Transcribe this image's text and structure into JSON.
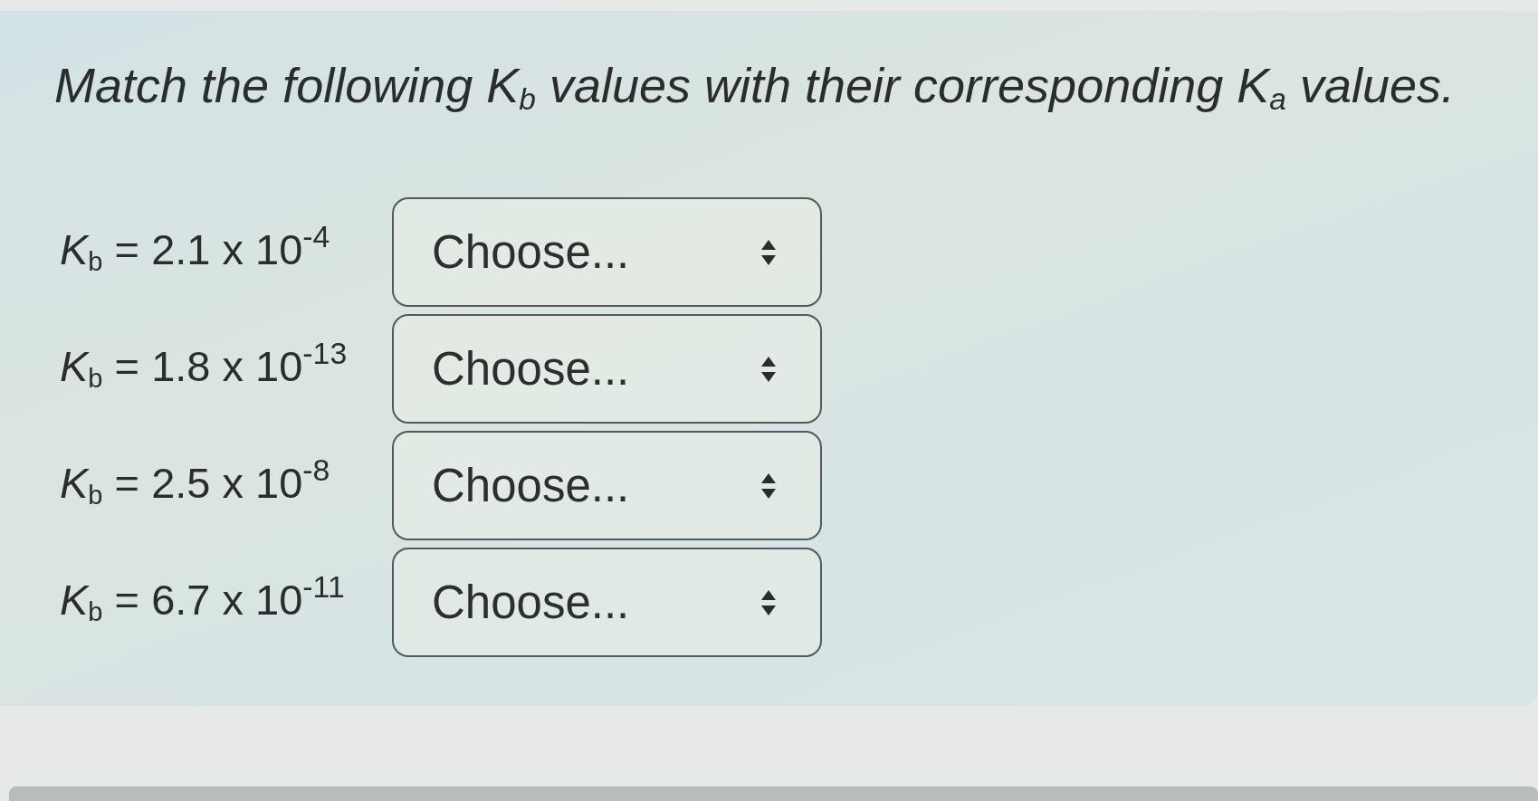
{
  "question": {
    "text": "Match the following K$_{b}$ values with their corresponding K$_{a}$ values."
  },
  "rows": [
    {
      "label": "*K*$_{b}$ = 2.1 x 10$^{-4}$",
      "dropdown": {
        "value": "Choose..."
      }
    },
    {
      "label": "*K*$_{b}$ = 1.8 x 10$^{-13}$",
      "dropdown": {
        "value": "Choose..."
      }
    },
    {
      "label": "*K*$_{b}$ = 2.5 x 10$^{-8}$",
      "dropdown": {
        "value": "Choose..."
      }
    },
    {
      "label": "*K*$_{b}$ = 6.7 x 10$^{-11}$",
      "dropdown": {
        "value": "Choose..."
      }
    }
  ]
}
